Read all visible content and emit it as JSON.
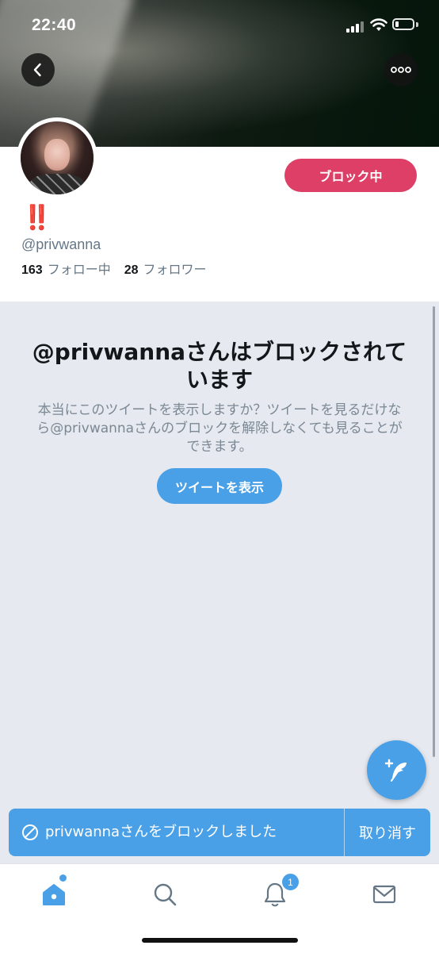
{
  "status_bar": {
    "time": "22:40",
    "battery_level": 0.22
  },
  "header": {
    "back_icon": "chevron-left-icon",
    "more_icon": "more-horizontal-icon"
  },
  "profile": {
    "display_name": "‼️",
    "handle": "@privwanna",
    "block_status_label": "ブロック中",
    "following_count": "163",
    "following_label": "フォロー中",
    "followers_count": "28",
    "followers_label": "フォロワー"
  },
  "blocked_notice": {
    "title": "@privwannaさんはブロックされています",
    "description": "本当にこのツイートを表示しますか？ツイートを見るだけなら@privwannaさんのブロックを解除しなくても見ることができます。",
    "show_tweets_label": "ツイートを表示"
  },
  "toast": {
    "message": "privwannaさんをブロックしました",
    "undo_label": "取り消す"
  },
  "tab_bar": {
    "notification_badge": "1",
    "tabs": [
      "home-icon",
      "search-icon",
      "bell-icon",
      "mail-icon"
    ]
  },
  "colors": {
    "accent": "#4aa0e6",
    "block_red": "#dd3f67",
    "background_gray": "#e6e9ef"
  }
}
